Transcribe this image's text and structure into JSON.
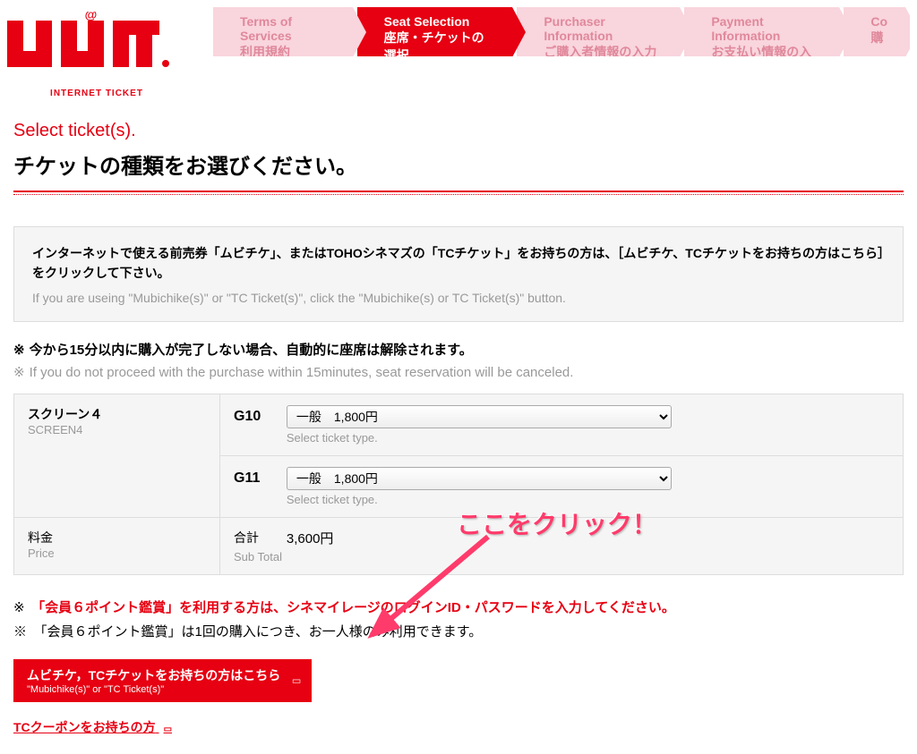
{
  "logo": {
    "sub": "INTERNET TICKET"
  },
  "steps": [
    {
      "en": "Terms of Services",
      "jp": "利用規約"
    },
    {
      "en": "Seat Selection",
      "jp": "座席・チケットの選択"
    },
    {
      "en": "Purchaser Information",
      "jp": "ご購入者情報の入力"
    },
    {
      "en": "Payment Information",
      "jp": "お支払い情報の入力"
    },
    {
      "en": "Co",
      "jp": "購"
    }
  ],
  "page_title": {
    "en": "Select ticket(s).",
    "jp": "チケットの種類をお選びください。"
  },
  "info_box": {
    "jp": "インターネットで使える前売券「ムビチケ」、またはTOHOシネマズの「TCチケット」をお持ちの方は、［ムビチケ、TCチケットをお持ちの方はこちら］をクリックして下さい。",
    "en": "If you are useing \"Mubichike(s)\" or \"TC Ticket(s)\", click the \"Mubichike(s) or TC Ticket(s)\" button."
  },
  "notices": {
    "jp": "今から15分以内に購入が完了しない場合、自動的に座席は解除されます。",
    "en": "If you do not proceed with the purchase within 15minutes, seat reservation will be canceled."
  },
  "asterisk": "※",
  "screen": {
    "jp": "スクリーン４",
    "en": "SCREEN4"
  },
  "seats": [
    {
      "code": "G10",
      "option": "一般　1,800円"
    },
    {
      "code": "G11",
      "option": "一般　1,800円"
    }
  ],
  "select_hint": "Select ticket type.",
  "price": {
    "label_jp": "料金",
    "label_en": "Price",
    "subtotal_jp": "合計",
    "subtotal_en": "Sub Total",
    "value": "3,600円"
  },
  "member": {
    "line1_prefix": "※",
    "line1_red": "「会員６ポイント鑑賞」を利用する方は、シネマイレージのログインID・パスワードを入力してください。",
    "line2": "※　「会員６ポイント鑑賞」は1回の購入につき、お一人様のみ利用できます。"
  },
  "mubichike_btn": {
    "jp": "ムビチケ，TCチケットをお持ちの方はこちら",
    "en": "\"Mubichike(s)\"  or  \"TC Ticket(s)\""
  },
  "coupon_link": "TCクーポンをお持ちの方",
  "annotation_text": "ここをクリック！"
}
